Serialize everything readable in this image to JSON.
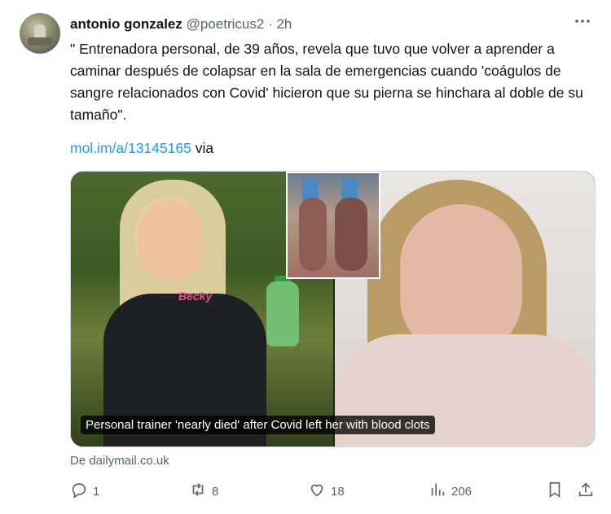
{
  "tweet": {
    "author_name": "antonio gonzalez",
    "author_handle": "@poetricus2",
    "separator": "·",
    "time": "2h",
    "more_icon": "more-horizontal-icon",
    "text": "\" Entrenadora personal, de 39 años, revela que tuvo que volver a aprender a caminar después de colapsar en la sala de emergencias cuando 'coágulos de sangre relacionados con Covid' hicieron que su pierna se hinchara al doble de su tamaño\".",
    "link_text": "mol.im/a/13145165",
    "link_suffix": " via"
  },
  "card": {
    "jacket_text": "Becky",
    "caption": "Personal trainer 'nearly died' after Covid left her with blood clots",
    "source": "De dailymail.co.uk"
  },
  "actions": {
    "reply_count": "1",
    "retweet_count": "8",
    "like_count": "18",
    "views_count": "206",
    "icons": [
      "reply-icon",
      "retweet-icon",
      "like-icon",
      "views-icon",
      "bookmark-icon",
      "share-icon"
    ]
  },
  "colors": {
    "link": "#1d9bf0",
    "secondary_text": "#536471",
    "primary_text": "#0f1419"
  }
}
